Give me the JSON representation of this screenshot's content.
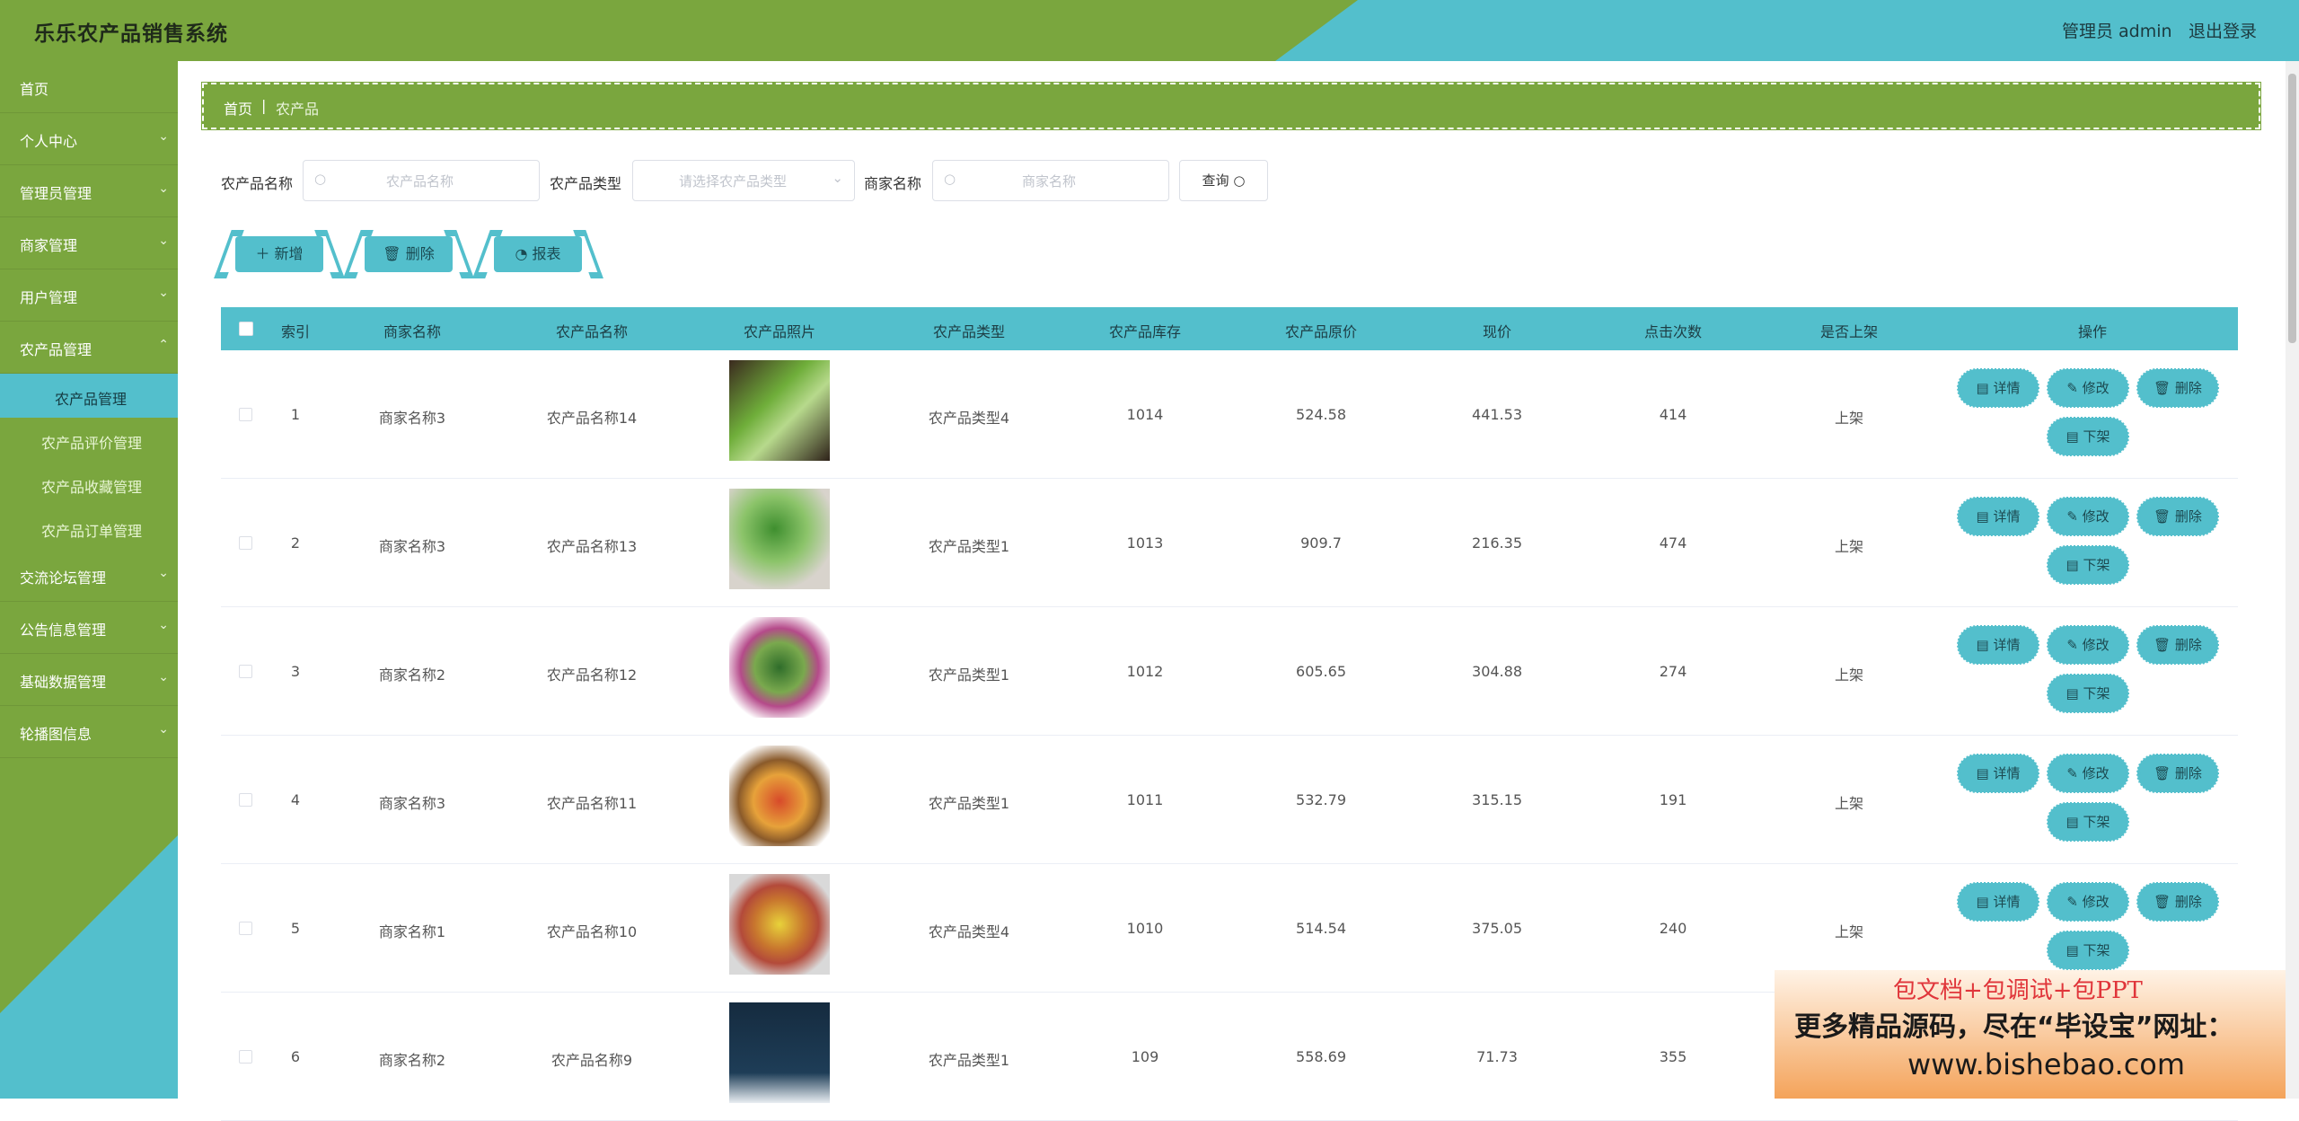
{
  "header": {
    "title": "乐乐农产品销售系统",
    "admin_label": "管理员 admin",
    "logout_label": "退出登录"
  },
  "sidebar": {
    "items": [
      {
        "label": "首页"
      },
      {
        "label": "个人中心"
      },
      {
        "label": "管理员管理"
      },
      {
        "label": "商家管理"
      },
      {
        "label": "用户管理"
      },
      {
        "label": "农产品管理"
      },
      {
        "label": "农产品管理"
      },
      {
        "label": "农产品评价管理"
      },
      {
        "label": "农产品收藏管理"
      },
      {
        "label": "农产品订单管理"
      },
      {
        "label": "交流论坛管理"
      },
      {
        "label": "公告信息管理"
      },
      {
        "label": "基础数据管理"
      },
      {
        "label": "轮播图信息"
      }
    ]
  },
  "breadcrumb": {
    "home": "首页",
    "sep": "|",
    "current": "农产品"
  },
  "search": {
    "name_label": "农产品名称",
    "name_placeholder": "农产品名称",
    "type_label": "农产品类型",
    "type_placeholder": "请选择农产品类型",
    "merchant_label": "商家名称",
    "merchant_placeholder": "商家名称",
    "query_label": "查询"
  },
  "actions": {
    "add": "新增",
    "delete": "删除",
    "report": "报表"
  },
  "table": {
    "headers": [
      "索引",
      "商家名称",
      "农产品名称",
      "农产品照片",
      "农产品类型",
      "农产品库存",
      "农产品原价",
      "现价",
      "点击次数",
      "是否上架",
      "操作"
    ],
    "rows": [
      {
        "index": "1",
        "merchant": "商家名称3",
        "name": "农产品名称14",
        "type": "农产品类型4",
        "stock": "1014",
        "orig": "524.58",
        "price": "441.53",
        "clicks": "414",
        "status": "上架"
      },
      {
        "index": "2",
        "merchant": "商家名称3",
        "name": "农产品名称13",
        "type": "农产品类型1",
        "stock": "1013",
        "orig": "909.7",
        "price": "216.35",
        "clicks": "474",
        "status": "上架"
      },
      {
        "index": "3",
        "merchant": "商家名称2",
        "name": "农产品名称12",
        "type": "农产品类型1",
        "stock": "1012",
        "orig": "605.65",
        "price": "304.88",
        "clicks": "274",
        "status": "上架"
      },
      {
        "index": "4",
        "merchant": "商家名称3",
        "name": "农产品名称11",
        "type": "农产品类型1",
        "stock": "1011",
        "orig": "532.79",
        "price": "315.15",
        "clicks": "191",
        "status": "上架"
      },
      {
        "index": "5",
        "merchant": "商家名称1",
        "name": "农产品名称10",
        "type": "农产品类型4",
        "stock": "1010",
        "orig": "514.54",
        "price": "375.05",
        "clicks": "240",
        "status": "上架"
      },
      {
        "index": "6",
        "merchant": "商家名称2",
        "name": "农产品名称9",
        "type": "农产品类型1",
        "stock": "109",
        "orig": "558.69",
        "price": "71.73",
        "clicks": "355",
        "status": ""
      }
    ],
    "op_labels": {
      "detail": "详情",
      "edit": "修改",
      "delete": "删除",
      "off": "下架"
    }
  },
  "ad": {
    "line1": "包文档+包调试+包PPT",
    "line2": "更多精品源码，尽在“毕设宝”网址：",
    "line3": "www.bishebao.com"
  },
  "colors": {
    "green": "#7aa63e",
    "teal": "#53bfcc"
  }
}
